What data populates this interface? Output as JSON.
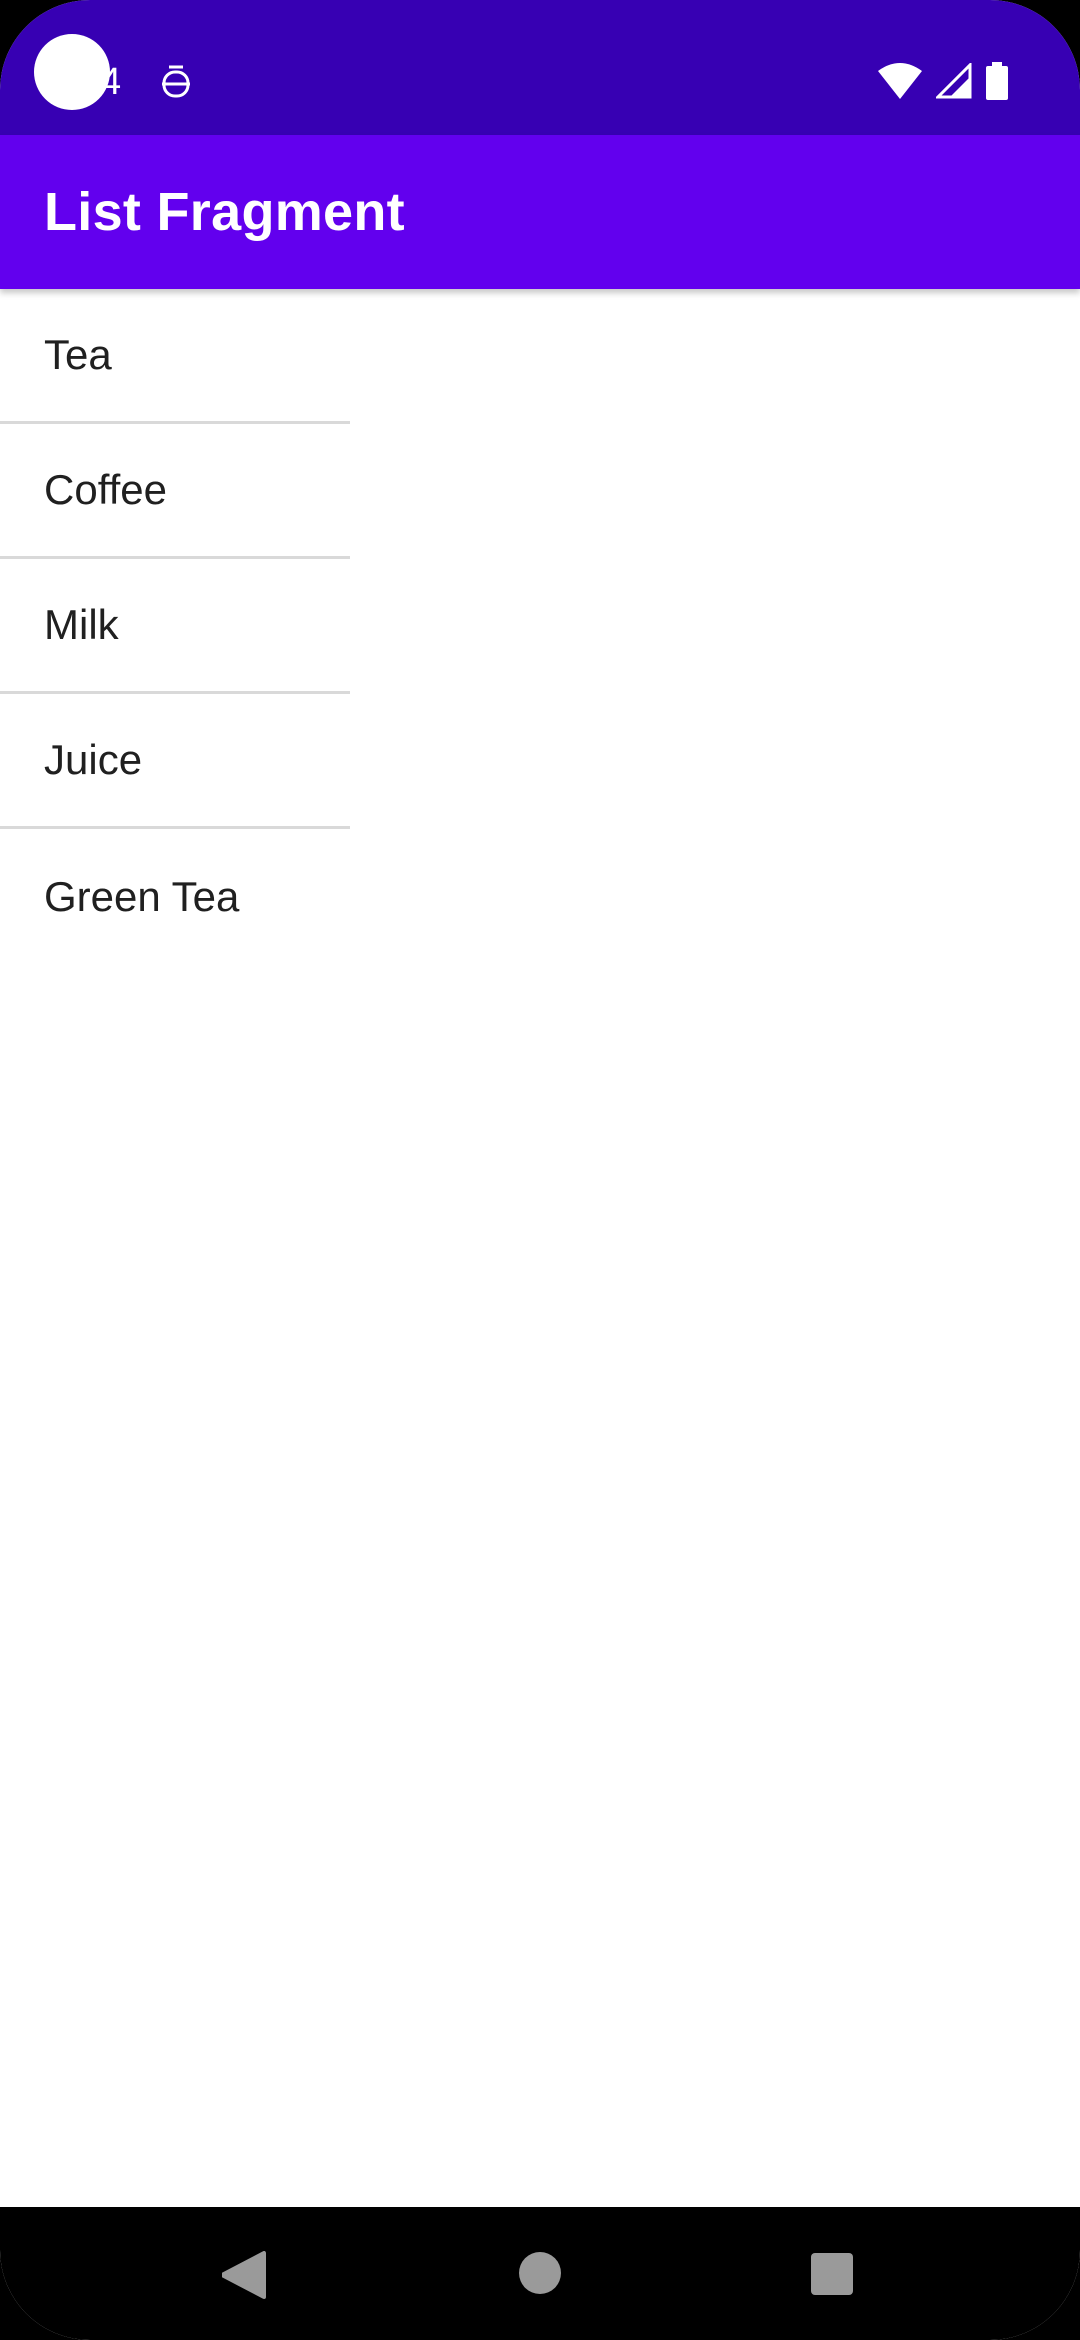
{
  "status_bar": {
    "time": "4",
    "icons": [
      "notification-face-icon",
      "wifi-icon",
      "cellular-signal-icon",
      "battery-icon"
    ],
    "background_color": "#3700B3"
  },
  "app_bar": {
    "title": "List Fragment",
    "background_color": "#6200EE"
  },
  "list": {
    "items": [
      {
        "label": "Tea"
      },
      {
        "label": "Coffee"
      },
      {
        "label": "Milk"
      },
      {
        "label": "Juice"
      },
      {
        "label": "Green Tea"
      }
    ]
  },
  "nav_bar": {
    "buttons": [
      "back-icon",
      "home-icon",
      "recents-icon"
    ]
  }
}
